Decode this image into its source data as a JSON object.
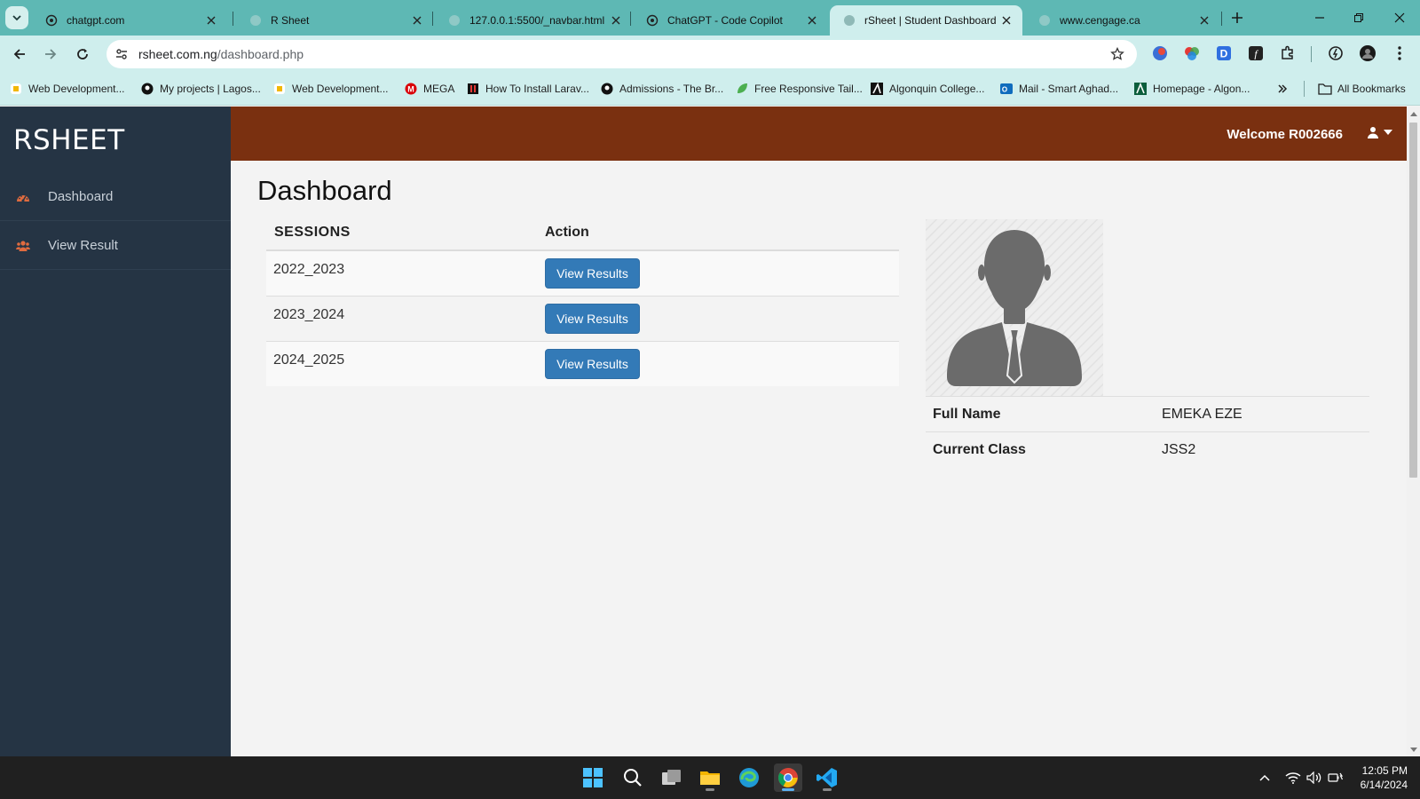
{
  "browser": {
    "tabs": [
      {
        "title": "chatgpt.com",
        "active": false
      },
      {
        "title": "R Sheet",
        "active": false
      },
      {
        "title": "127.0.0.1:5500/_navbar.html",
        "active": false
      },
      {
        "title": "ChatGPT - Code Copilot",
        "active": false
      },
      {
        "title": "rSheet | Student Dashboard",
        "active": true
      },
      {
        "title": "www.cengage.ca",
        "active": false
      }
    ],
    "url_host": "rsheet.com.ng",
    "url_path": "/dashboard.php",
    "bookmarks": [
      "Web Development...",
      "My projects | Lagos...",
      "Web Development...",
      "MEGA",
      "How To Install Larav...",
      "Admissions - The Br...",
      "Free Responsive Tail...",
      "Algonquin College...",
      "Mail - Smart Aghad...",
      "Homepage - Algon..."
    ],
    "all_bookmarks_label": "All Bookmarks"
  },
  "app": {
    "brand": "RSHEET",
    "sidebar": {
      "items": [
        {
          "label": "Dashboard",
          "icon": "dashboard-icon"
        },
        {
          "label": "View Result",
          "icon": "users-icon"
        }
      ]
    },
    "topnav": {
      "welcome": "Welcome R002666"
    },
    "accent_color": "#7a3010",
    "sidebar_color": "#253444",
    "button_color": "#337ab7"
  },
  "main": {
    "title": "Dashboard",
    "table": {
      "headers": [
        "SESSIONS",
        "Action"
      ],
      "rows": [
        {
          "session": "2022_2023",
          "action": "View Results"
        },
        {
          "session": "2023_2024",
          "action": "View Results"
        },
        {
          "session": "2024_2025",
          "action": "View Results"
        }
      ]
    },
    "profile": {
      "full_name_label": "Full Name",
      "full_name": "EMEKA EZE",
      "class_label": "Current Class",
      "class": "JSS2"
    }
  },
  "taskbar": {
    "time": "12:05 PM",
    "date": "6/14/2024"
  }
}
